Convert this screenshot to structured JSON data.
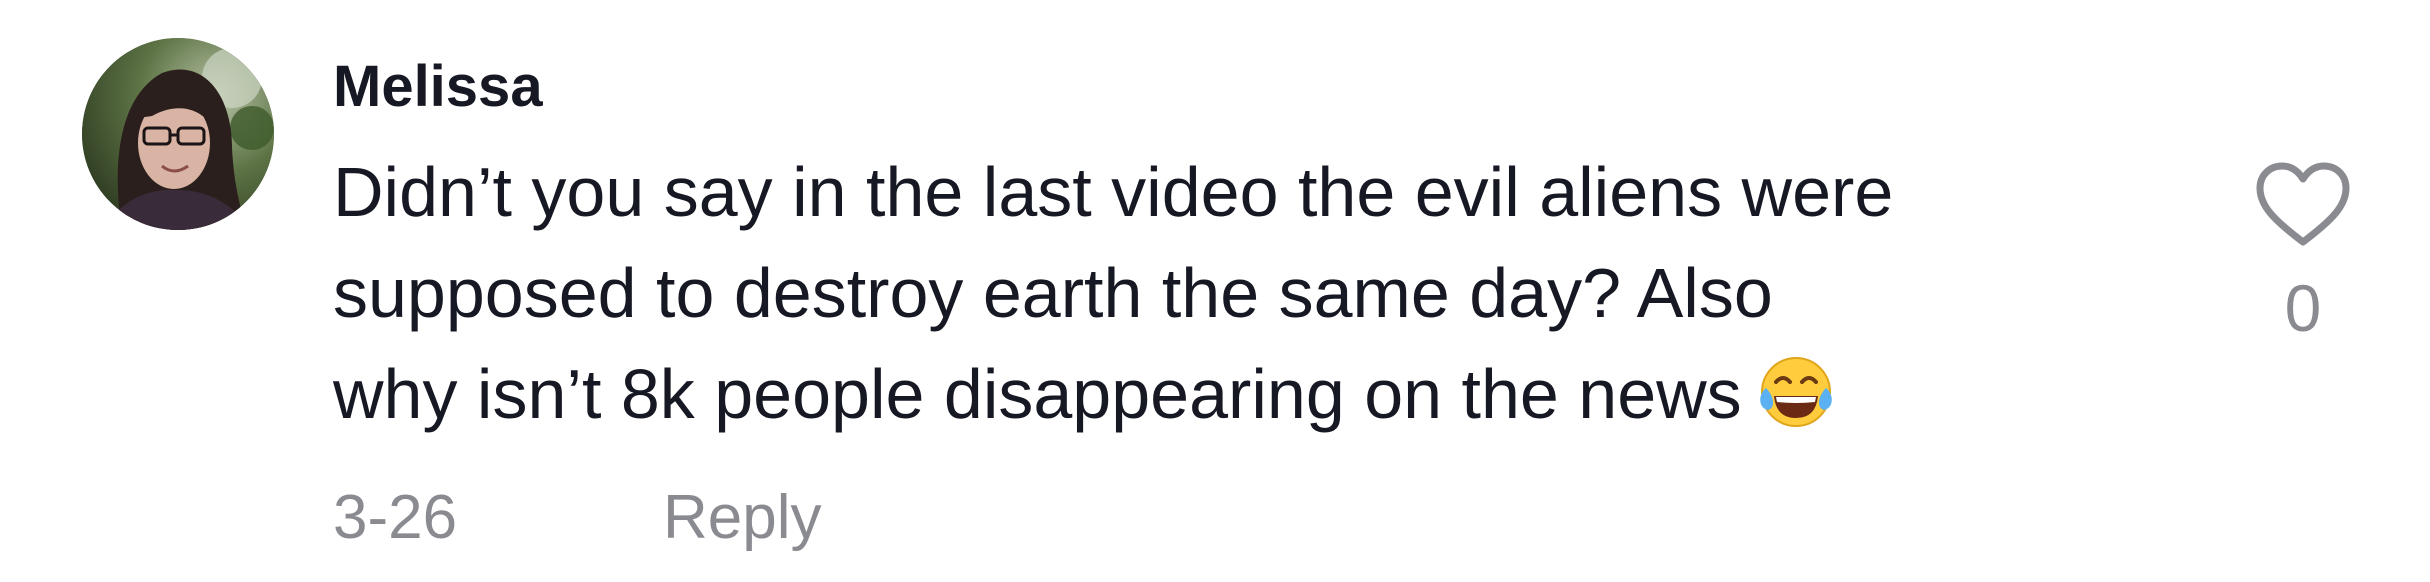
{
  "comment": {
    "username": "Melissa",
    "text_lines": [
      "Didn’t you say in the last video the evil aliens were",
      "supposed to destroy earth the same day? Also",
      "why isn’t 8k people disappearing on the news"
    ],
    "emoji": "face-with-tears-of-joy-icon",
    "date": "3-26",
    "reply_label": "Reply",
    "like_count": "0",
    "like_icon": "heart-outline-icon",
    "colors": {
      "text_primary": "#161823",
      "text_secondary": "#8a8b91",
      "background": "#ffffff"
    }
  }
}
